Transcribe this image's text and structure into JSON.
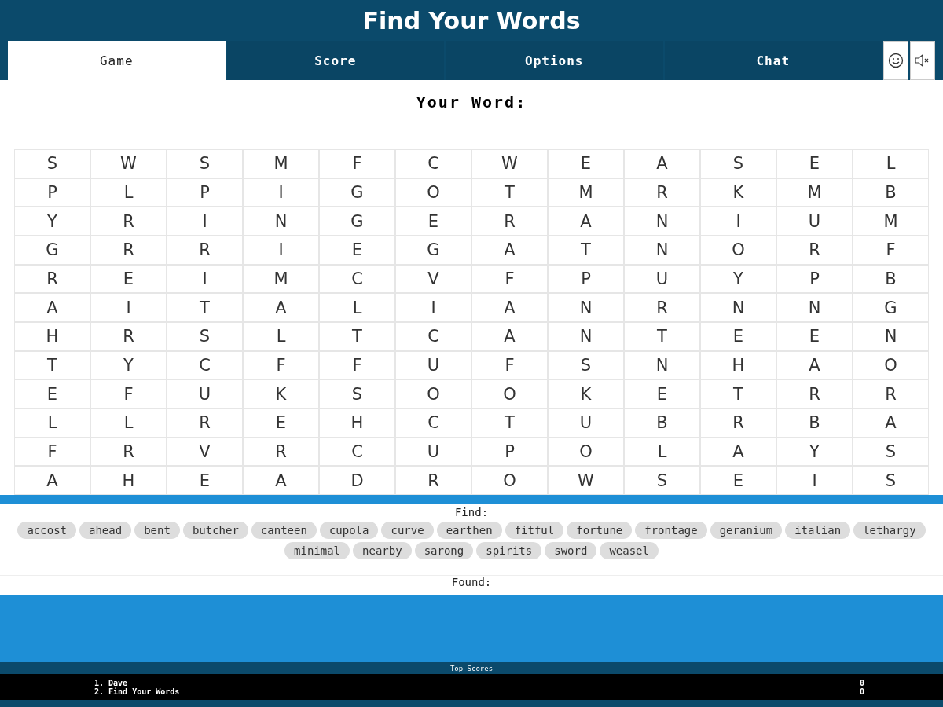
{
  "title": "Find Your Words",
  "tabs": [
    {
      "label": "Game",
      "selected": true
    },
    {
      "label": "Score",
      "selected": false
    },
    {
      "label": "Options",
      "selected": false
    },
    {
      "label": "Chat",
      "selected": false
    }
  ],
  "your_word_label": "Your Word:",
  "grid": [
    [
      "S",
      "W",
      "S",
      "M",
      "F",
      "C",
      "W",
      "E",
      "A",
      "S",
      "E",
      "L"
    ],
    [
      "P",
      "L",
      "P",
      "I",
      "G",
      "O",
      "T",
      "M",
      "R",
      "K",
      "M",
      "B"
    ],
    [
      "Y",
      "R",
      "I",
      "N",
      "G",
      "E",
      "R",
      "A",
      "N",
      "I",
      "U",
      "M"
    ],
    [
      "G",
      "R",
      "R",
      "I",
      "E",
      "G",
      "A",
      "T",
      "N",
      "O",
      "R",
      "F"
    ],
    [
      "R",
      "E",
      "I",
      "M",
      "C",
      "V",
      "F",
      "P",
      "U",
      "Y",
      "P",
      "B"
    ],
    [
      "A",
      "I",
      "T",
      "A",
      "L",
      "I",
      "A",
      "N",
      "R",
      "N",
      "N",
      "G"
    ],
    [
      "H",
      "R",
      "S",
      "L",
      "T",
      "C",
      "A",
      "N",
      "T",
      "E",
      "E",
      "N"
    ],
    [
      "T",
      "Y",
      "C",
      "F",
      "F",
      "U",
      "F",
      "S",
      "N",
      "H",
      "A",
      "O"
    ],
    [
      "E",
      "F",
      "U",
      "K",
      "S",
      "O",
      "O",
      "K",
      "E",
      "T",
      "R",
      "R"
    ],
    [
      "L",
      "L",
      "R",
      "E",
      "H",
      "C",
      "T",
      "U",
      "B",
      "R",
      "B",
      "A"
    ],
    [
      "F",
      "R",
      "V",
      "R",
      "C",
      "U",
      "P",
      "O",
      "L",
      "A",
      "Y",
      "S"
    ],
    [
      "A",
      "H",
      "E",
      "A",
      "D",
      "R",
      "O",
      "W",
      "S",
      "E",
      "I",
      "S"
    ]
  ],
  "find_label": "Find:",
  "find_words": [
    "accost",
    "ahead",
    "bent",
    "butcher",
    "canteen",
    "cupola",
    "curve",
    "earthen",
    "fitful",
    "fortune",
    "frontage",
    "geranium",
    "italian",
    "lethargy",
    "minimal",
    "nearby",
    "sarong",
    "spirits",
    "sword",
    "weasel"
  ],
  "found_label": "Found:",
  "top_scores": {
    "title": "Top Scores",
    "rows": [
      {
        "name": "1. Dave",
        "score": "0"
      },
      {
        "name": "2. Find Your Words",
        "score": "0"
      }
    ]
  }
}
